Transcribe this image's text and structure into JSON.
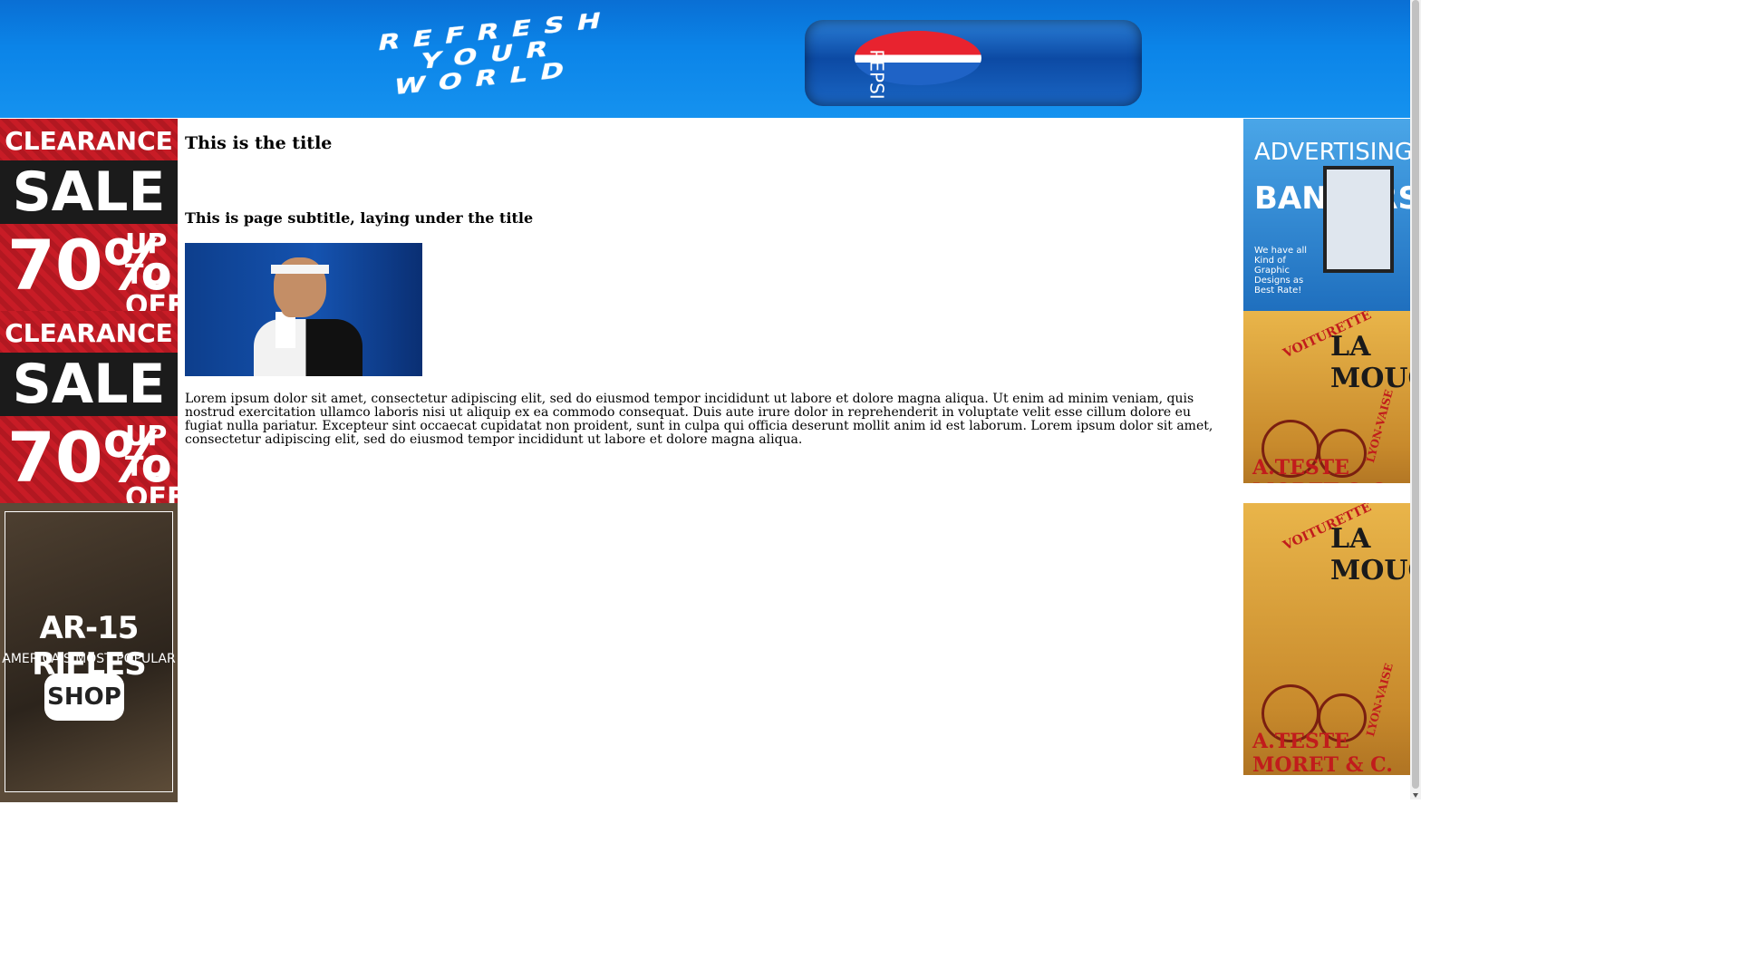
{
  "top_banner": {
    "slogan_lines": [
      "REFRESH",
      "YOUR",
      "WORLD"
    ],
    "brand": "PEPSI"
  },
  "left_ads": {
    "clearance": [
      {
        "line1": "CLEARANCE",
        "line2": "SALE",
        "percent": "70%",
        "suffix": "UP TO OFF"
      },
      {
        "line1": "CLEARANCE",
        "line2": "SALE",
        "percent": "70%",
        "suffix": "UP TO OFF"
      }
    ],
    "rifle": {
      "title": "AR-15 RIFLES",
      "subtitle": "AMERICA'S MOST POPULAR",
      "button": "SHOP"
    }
  },
  "right_ads": {
    "banners": {
      "line1": "ADVERTISING",
      "line2": "BANNERS",
      "caption": "We have all Kind of Graphic Designs as Best Rate!"
    },
    "vintage": [
      {
        "top": "VOITURETTE",
        "title": "LA MOUCHE",
        "bottom": "A.TESTE MORET & C.",
        "side": "LYON-VAISE"
      },
      {
        "top": "VOITURETTE",
        "title": "LA MOUCHE",
        "bottom": "A.TESTE MORET & C.",
        "side": "LYON-VAISE"
      }
    ]
  },
  "main": {
    "title": "This is the title",
    "subtitle": "This is page subtitle, laying under the title",
    "paragraph": "Lorem ipsum dolor sit amet, consectetur adipiscing elit, sed do eiusmod tempor incididunt ut labore et dolore magna aliqua. Ut enim ad minim veniam, quis nostrud exercitation ullamco laboris nisi ut aliquip ex ea commodo consequat. Duis aute irure dolor in reprehenderit in voluptate velit esse cillum dolore eu fugiat nulla pariatur. Excepteur sint occaecat cupidatat non proident, sunt in culpa qui officia deserunt mollit anim id est laborum. Lorem ipsum dolor sit amet, consectetur adipiscing elit, sed do eiusmod tempor incididunt ut labore et dolore magna aliqua."
  }
}
